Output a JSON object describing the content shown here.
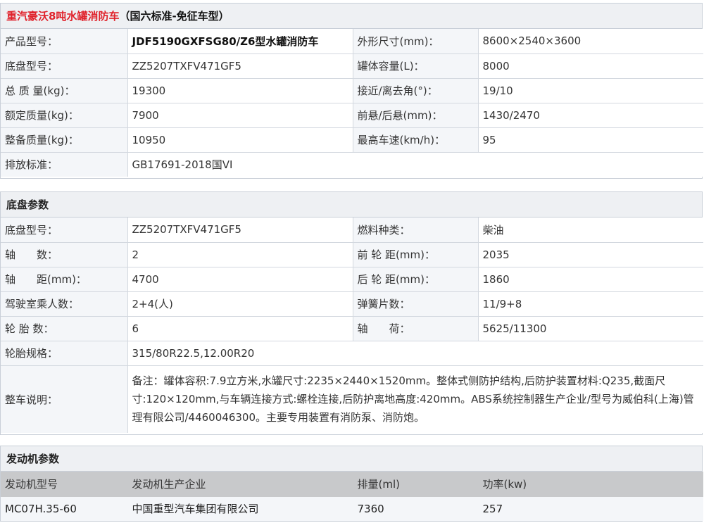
{
  "header": {
    "title_red": "重汽豪沃8吨水罐消防车",
    "title_dark": "（国六标准-免征车型）"
  },
  "basic": [
    {
      "l1": "产品型号：",
      "v1": "JDF5190GXFSG80/Z6型水罐消防车",
      "l2": "外形尺寸(mm)：",
      "v2": "8600×2540×3600"
    },
    {
      "l1": "底盘型号：",
      "v1": "ZZ5207TXFV471GF5",
      "l2": "罐体容量(L)：",
      "v2": "8000"
    },
    {
      "l1": "总 质 量(kg)：",
      "v1": "19300",
      "l2": "接近/离去角(°)：",
      "v2": "19/10"
    },
    {
      "l1": "额定质量(kg)：",
      "v1": "7900",
      "l2": "前悬/后悬(mm)：",
      "v2": "1430/2470"
    },
    {
      "l1": "整备质量(kg)：",
      "v1": "10950",
      "l2": "最高车速(km/h)：",
      "v2": "95"
    },
    {
      "l1": "排放标准：",
      "v1": "GB17691-2018国VI"
    }
  ],
  "chassis": {
    "title": "底盘参数",
    "rows": [
      {
        "l1": "底盘型号：",
        "v1": "ZZ5207TXFV471GF5",
        "l2": "燃料种类：",
        "v2": "柴油"
      },
      {
        "l1": "轴　　数：",
        "v1": "2",
        "l2": "前 轮 距(mm)：",
        "v2": "2035"
      },
      {
        "l1": "轴　　距(mm)：",
        "v1": "4700",
        "l2": "后 轮 距(mm)：",
        "v2": "1860"
      },
      {
        "l1": "驾驶室乘人数：",
        "v1": "2+4(人)",
        "l2": "弹簧片数：",
        "v2": "11/9+8"
      },
      {
        "l1": "轮 胎 数：",
        "v1": "6",
        "l2": "轴　　荷：",
        "v2": "5625/11300"
      },
      {
        "l1": "轮胎规格：",
        "v1": "315/80R22.5,12.00R20"
      }
    ],
    "note_label": "整车说明：",
    "note_text": "备注：罐体容积:7.9立方米,水罐尺寸:2235×2440×1520mm。整体式侧防护结构,后防护装置材料:Q235,截面尺寸:120×120mm,与车辆连接方式:螺栓连接,后防护离地高度:420mm。ABS系统控制器生产企业/型号为威伯科(上海)管理有限公司/4460046300。主要专用装置有消防泵、消防炮。"
  },
  "engine": {
    "title": "发动机参数",
    "headers": [
      "发动机型号",
      "发动机生产企业",
      "排量(ml)",
      "功率(kw)"
    ],
    "row": [
      "MC07H.35-60",
      "中国重型汽车集团有限公司",
      "7360",
      "257"
    ]
  }
}
